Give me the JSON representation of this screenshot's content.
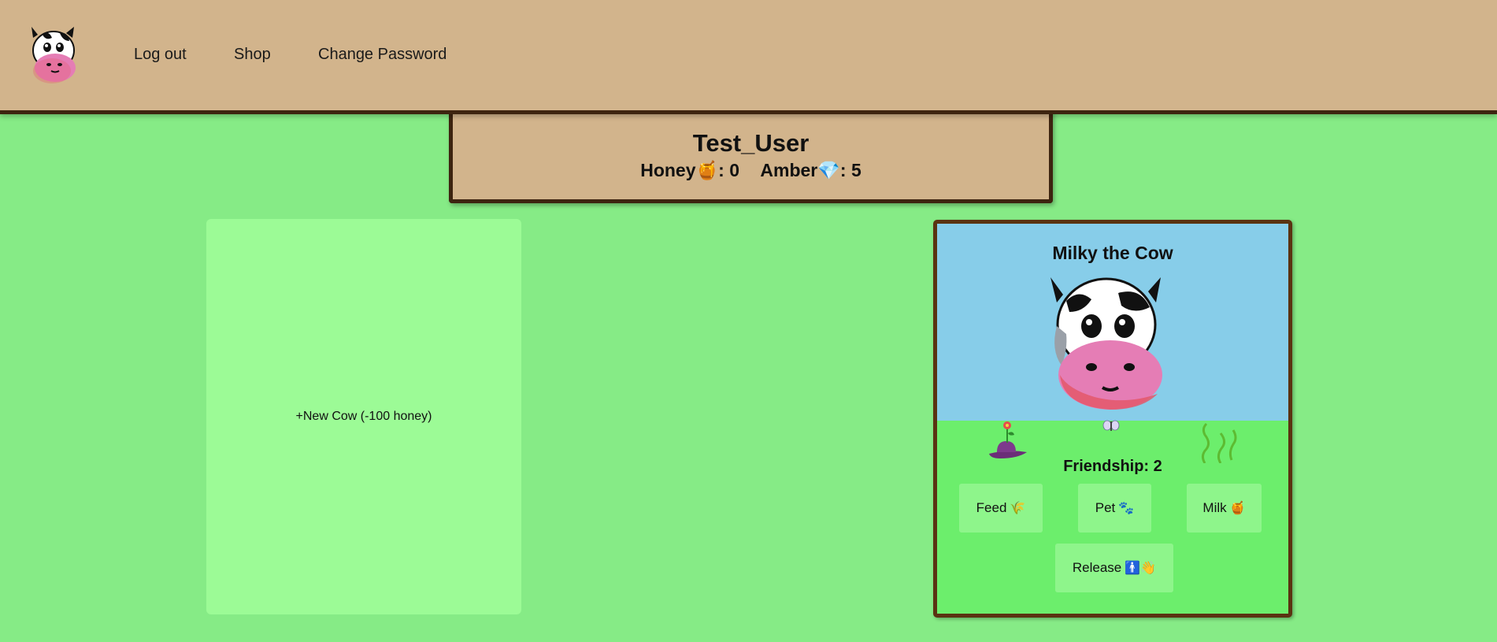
{
  "nav": {
    "links": [
      "Log out",
      "Shop",
      "Change Password"
    ]
  },
  "user": {
    "name": "Test_User",
    "honey_label": "Honey",
    "honey_icon": "🍯",
    "honey_value": "0",
    "amber_label": "Amber",
    "amber_icon": "💎",
    "amber_value": "5"
  },
  "new_cow": {
    "label": "+New Cow (-100 honey)"
  },
  "cow": {
    "name": "Milky the Cow",
    "friendship_label": "Friendship: 2",
    "actions": {
      "feed": "Feed",
      "feed_icon": "🌾",
      "pet": "Pet",
      "pet_icon": "🐾",
      "milk": "Milk",
      "milk_icon": "🍯",
      "release": "Release",
      "release_icon": "🚹👋"
    }
  },
  "colors": {
    "background": "#86eb86",
    "topbar": "#d2b48c",
    "border": "#3d2410",
    "sky": "#87cde9",
    "grass": "#6cee6c",
    "button": "#8ef58b",
    "new_cow_card": "#9cfb96"
  },
  "icons": {
    "logo": "cow-face-icon",
    "cow": "cow-face-icon",
    "flower": "flower-hat-icon",
    "butterfly": "butterfly-icon",
    "weeds": "weeds-icon"
  }
}
